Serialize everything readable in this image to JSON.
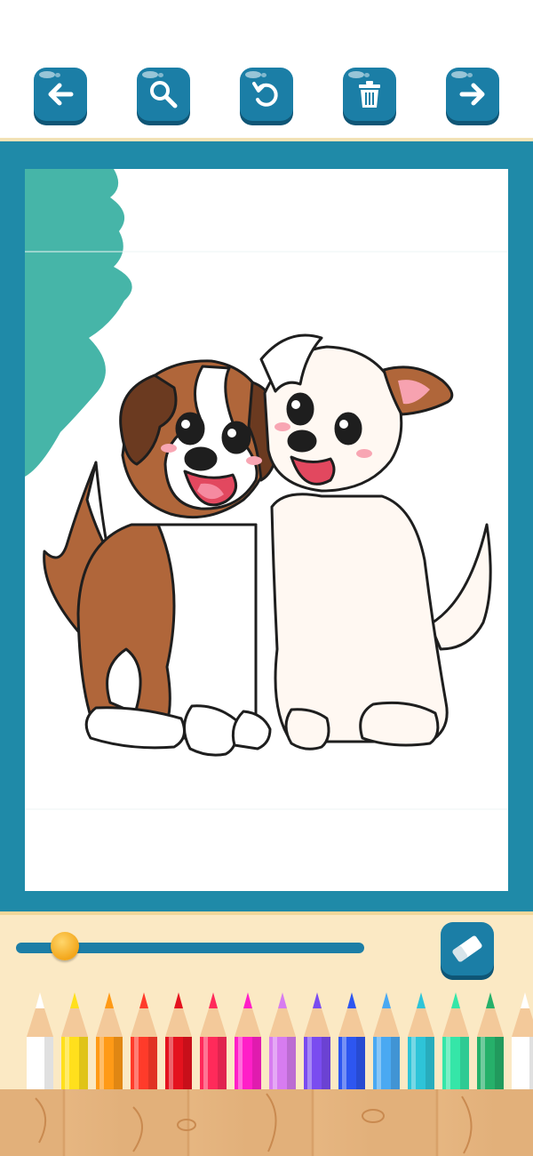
{
  "toolbar": {
    "buttons": [
      {
        "name": "back",
        "icon": "arrow-left-icon"
      },
      {
        "name": "zoom",
        "icon": "magnifier-icon"
      },
      {
        "name": "undo",
        "icon": "undo-icon"
      },
      {
        "name": "delete",
        "icon": "trash-icon"
      },
      {
        "name": "next",
        "icon": "arrow-right-icon"
      }
    ]
  },
  "canvas": {
    "image": "two-puppies-coloring-page",
    "painted_fill_color": "#46b5a8"
  },
  "brush_size": {
    "level": 0.14
  },
  "eraser": {
    "icon": "eraser-icon"
  },
  "palette": {
    "colors": [
      "#ffffff",
      "#ffe01c",
      "#ff9a16",
      "#ff3b2a",
      "#e4121e",
      "#ff2a5a",
      "#ff1fc8",
      "#d77cf0",
      "#7a4cf0",
      "#2d56f0",
      "#4aa9f2",
      "#2ec4d8",
      "#35e6a8",
      "#26b06a",
      "#ffffff"
    ]
  },
  "theme": {
    "accent": "#1b7ea6",
    "frame": "#1f8aa8",
    "panel": "#fbe9c4",
    "wood": "#e2b07a"
  }
}
